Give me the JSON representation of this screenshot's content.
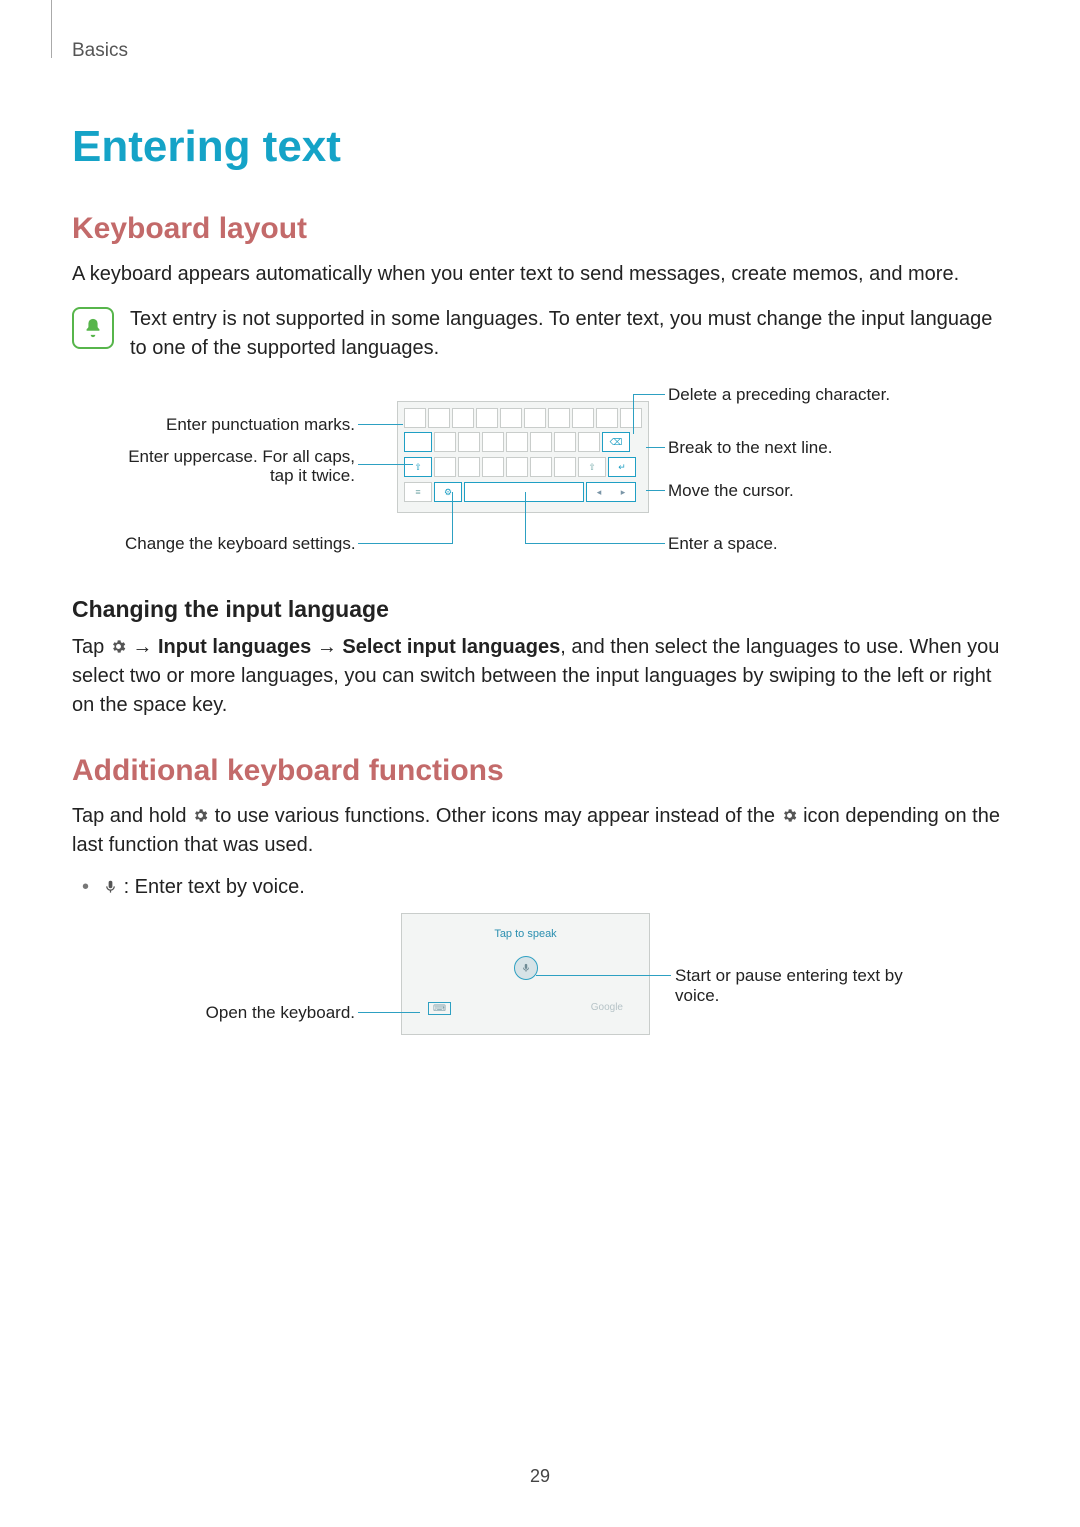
{
  "running_head": "Basics",
  "h1": "Entering text",
  "section_keyboard": {
    "title": "Keyboard layout",
    "p1": "A keyboard appears automatically when you enter text to send messages, create memos, and more.",
    "note": "Text entry is not supported in some languages. To enter text, you must change the input language to one of the supported languages."
  },
  "callouts": {
    "punct": "Enter punctuation marks.",
    "shift_l1": "Enter uppercase. For all caps,",
    "shift_l2": "tap it twice.",
    "settings": "Change the keyboard settings.",
    "delete": "Delete a preceding character.",
    "enter": "Break to the next line.",
    "cursor": "Move the cursor.",
    "space": "Enter a space."
  },
  "changing": {
    "title": "Changing the input language",
    "tap": "Tap ",
    "arrow1": " → ",
    "b1": "Input languages",
    "arrow2": " → ",
    "b2": "Select input languages",
    "rest": ", and then select the languages to use. When you select two or more languages, you can switch between the input languages by swiping to the left or right on the space key."
  },
  "additional": {
    "title": "Additional keyboard functions",
    "p_a": "Tap and hold ",
    "p_b": " to use various functions. Other icons may appear instead of the ",
    "p_c": " icon depending on the last function that was used.",
    "bullet": " : Enter text by voice."
  },
  "voice": {
    "title": "Tap to speak",
    "foot_right": "Google",
    "open_kbd": "Open the keyboard.",
    "start_l1": "Start or pause entering text by",
    "start_l2": "voice."
  },
  "page_number": "29"
}
